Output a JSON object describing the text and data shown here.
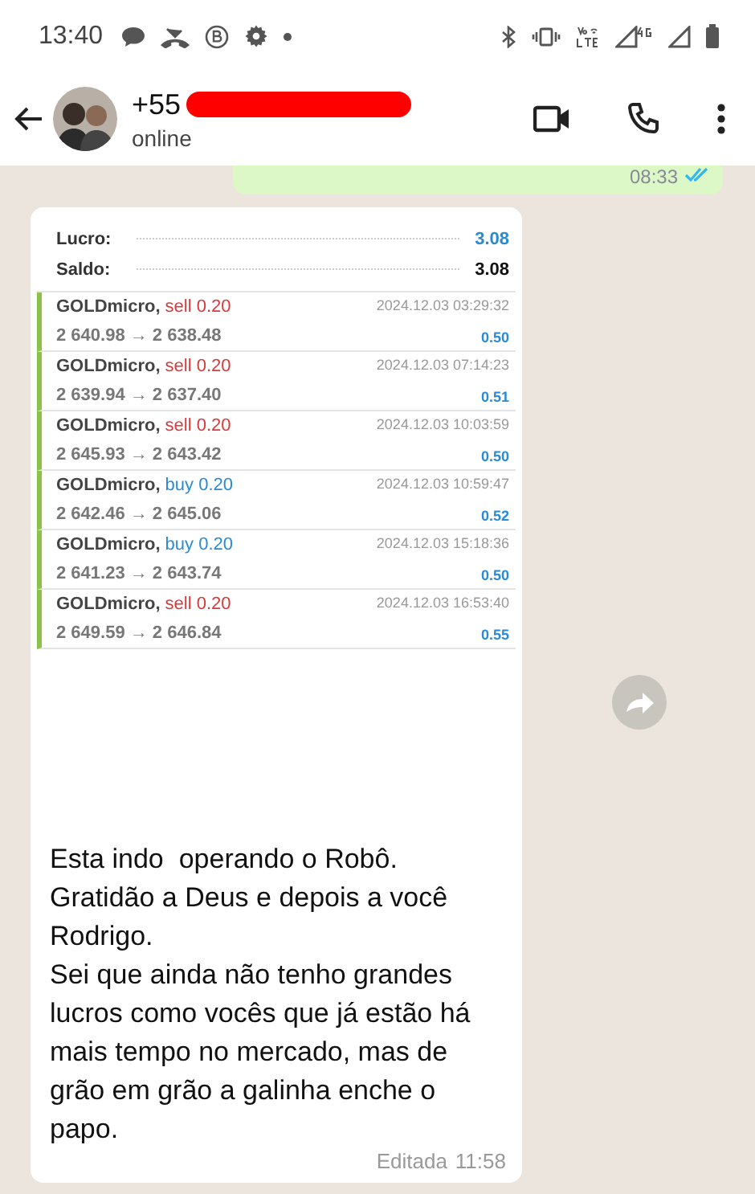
{
  "status_bar": {
    "time": "13:40"
  },
  "header": {
    "contact": "+55",
    "redacted": true,
    "presence": "online"
  },
  "previous_message": {
    "time": "08:33",
    "read": true
  },
  "message": {
    "report": {
      "summary": [
        {
          "label": "Lucro:",
          "value": "3.08",
          "kind": "profit"
        },
        {
          "label": "Saldo:",
          "value": "3.08",
          "kind": "balance"
        }
      ],
      "trades": [
        {
          "symbol": "GOLDmicro,",
          "color": "#d63b3b",
          "order": "sell 0.20",
          "prices": "2 640.98 → 2 638.48",
          "datetime": "2024.12.03 03:29:32",
          "profit": "0.50"
        },
        {
          "symbol": "GOLDmicro,",
          "color": "#d63b3b",
          "order": "sell 0.20",
          "prices": "2 639.94 → 2 637.40",
          "datetime": "2024.12.03 07:14:23",
          "profit": "0.51"
        },
        {
          "symbol": "GOLDmicro,",
          "color": "#d63b3b",
          "order": "sell 0.20",
          "prices": "2 645.93 → 2 643.42",
          "datetime": "2024.12.03 10:03:59",
          "profit": "0.50"
        },
        {
          "symbol": "GOLDmicro,",
          "color": "#2a8ad4",
          "order": "buy 0.20",
          "prices": "2 642.46 → 2 645.06",
          "datetime": "2024.12.03 10:59:47",
          "profit": "0.52"
        },
        {
          "symbol": "GOLDmicro,",
          "color": "#2a8ad4",
          "order": "buy 0.20",
          "prices": "2 641.23 → 2 643.74",
          "datetime": "2024.12.03 15:18:36",
          "profit": "0.50"
        },
        {
          "symbol": "GOLDmicro,",
          "color": "#d63b3b",
          "order": "sell 0.20",
          "prices": "2 649.59 → 2 646.84",
          "datetime": "2024.12.03 16:53:40",
          "profit": "0.55"
        }
      ]
    },
    "text": "Esta indo  operando o Robô.\nGratidão a Deus e depois a você Rodrigo.\nSei que ainda não tenho grandes lucros como vocês que já estão há mais tempo no mercado, mas de grão em grão a galinha enche o papo.",
    "edited_label": "Editada",
    "time": "11:58"
  }
}
